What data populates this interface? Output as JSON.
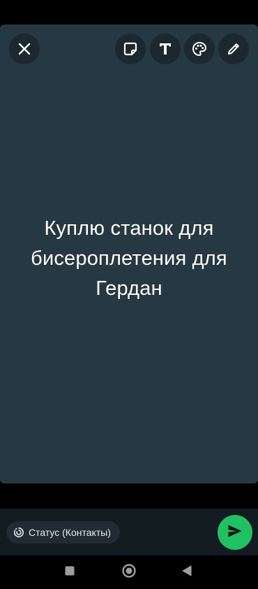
{
  "status_text": {
    "lines": [
      "Куплю станок для",
      "бисероплетения для",
      "Гердан"
    ],
    "background_color": "#263841",
    "text_color": "#ffffff"
  },
  "toolbar": {
    "left": [
      {
        "icon": "close-icon"
      }
    ],
    "right": [
      {
        "icon": "sticker-icon"
      },
      {
        "icon": "text-icon",
        "glyph": "T"
      },
      {
        "icon": "palette-icon"
      },
      {
        "icon": "pencil-icon"
      }
    ]
  },
  "footer": {
    "audience_icon": "status-ring-icon",
    "audience_label": "Статус (Контакты)",
    "send_icon": "send-icon",
    "send_color": "#21c063"
  },
  "system_nav": {
    "buttons": [
      {
        "icon": "recents-square-icon"
      },
      {
        "icon": "home-circle-icon"
      },
      {
        "icon": "back-triangle-icon"
      }
    ]
  }
}
